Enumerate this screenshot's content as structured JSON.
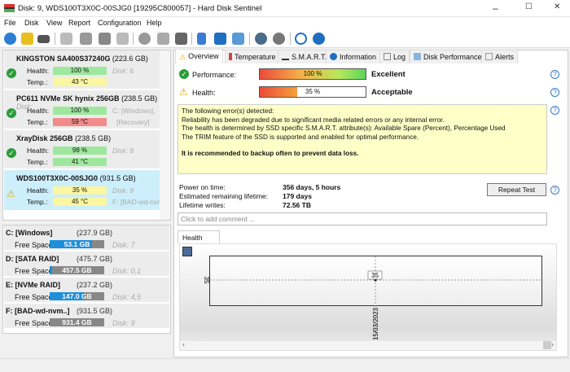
{
  "window": {
    "title": "Disk: 9, WDS100T3X0C-00SJG0 [19295C800057]  -  Hard Disk Sentinel",
    "minimize": "–",
    "maximize": "☐",
    "close": "✕"
  },
  "menu": [
    "File",
    "Disk",
    "View",
    "Report",
    "Configuration",
    "Help"
  ],
  "disks": [
    {
      "name": "KINGSTON SA400S37240G",
      "size": "(223.6 GB)",
      "health_label": "Health:",
      "health": "100 %",
      "health_pct": 100,
      "temp_label": "Temp.:",
      "temp": "43 °C",
      "side1": "Disk: 6",
      "side2": "",
      "status": "ok"
    },
    {
      "name": "PC611 NVMe SK hynix 256GB",
      "size": "(238.5 GB)",
      "health_label": "Health:",
      "health": "100 %",
      "health_pct": 100,
      "temp_label": "Temp.:",
      "temp": "59 °C",
      "side1": "C: [Windows],",
      "side2": "[Recovery]",
      "status": "ok",
      "extra": "Disk:"
    },
    {
      "name": "XrayDisk 256GB",
      "size": "(238.5 GB)",
      "health_label": "Health:",
      "health": "98 %",
      "health_pct": 98,
      "temp_label": "Temp.:",
      "temp": "41 °C",
      "side1": "Disk: 8",
      "side2": "",
      "status": "ok"
    },
    {
      "name": "WDS100T3X0C-00SJG0",
      "size": "(931.5 GB)",
      "health_label": "Health:",
      "health": "35 %",
      "health_pct": 35,
      "temp_label": "Temp.:",
      "temp": "45 °C",
      "side1": "Disk: 9",
      "side2": "F: [BAD-wd-nvm",
      "status": "warning"
    }
  ],
  "volumes": [
    {
      "name": "C: [Windows]",
      "size": "(237.9 GB)",
      "free_label": "Free Space",
      "free": "53.1 GB",
      "used_pct": 78,
      "disk": "Disk: 7"
    },
    {
      "name": "D: [SATA RAID]",
      "size": "(475.7 GB)",
      "free_label": "Free Space",
      "free": "457.5 GB",
      "used_pct": 4,
      "disk": "Disk: 0,1"
    },
    {
      "name": "E: [NVMe RAID]",
      "size": "(237.2 GB)",
      "free_label": "Free Space",
      "free": "147.0 GB",
      "used_pct": 62,
      "disk": "Disk: 4,5"
    },
    {
      "name": "F: [BAD-wd-nvm..]",
      "size": "(931.5 GB)",
      "free_label": "Free Space",
      "free": "931.4 GB",
      "used_pct": 0,
      "disk": "Disk: 9"
    }
  ],
  "tabs": [
    "Overview",
    "Temperature",
    "S.M.A.R.T.",
    "Information",
    "Log",
    "Disk Performance",
    "Alerts"
  ],
  "overview": {
    "performance_label": "Performance:",
    "performance": "100 %",
    "performance_pct": 100,
    "performance_rating": "Excellent",
    "health_label": "Health:",
    "health": "35 %",
    "health_pct": 35,
    "health_rating": "Acceptable",
    "messages": [
      "The following error(s) detected:",
      "Reliability has been degraded due to significant media related errors or any internal error.",
      "The health is determined by SSD specific S.M.A.R.T. attribute(s):  Available Spare (Percent), Percentage Used",
      "The TRIM feature of the SSD is supported and enabled for optimal performance."
    ],
    "recommendation": "It is recommended to backup often to prevent data loss.",
    "power_on_label": "Power on time:",
    "power_on": "356 days, 5 hours",
    "remaining_label": "Estimated remaining lifetime:",
    "remaining": "179 days",
    "writes_label": "Lifetime writes:",
    "writes": "72.56 TB",
    "repeat_test": "Repeat Test",
    "comment_placeholder": "Click to add comment ..."
  },
  "chart_data": {
    "type": "line",
    "tab": "Health (%)",
    "x": [
      "15/03/2023"
    ],
    "values": [
      35
    ],
    "y_tick": "35",
    "point_label": "35"
  },
  "help": "?"
}
